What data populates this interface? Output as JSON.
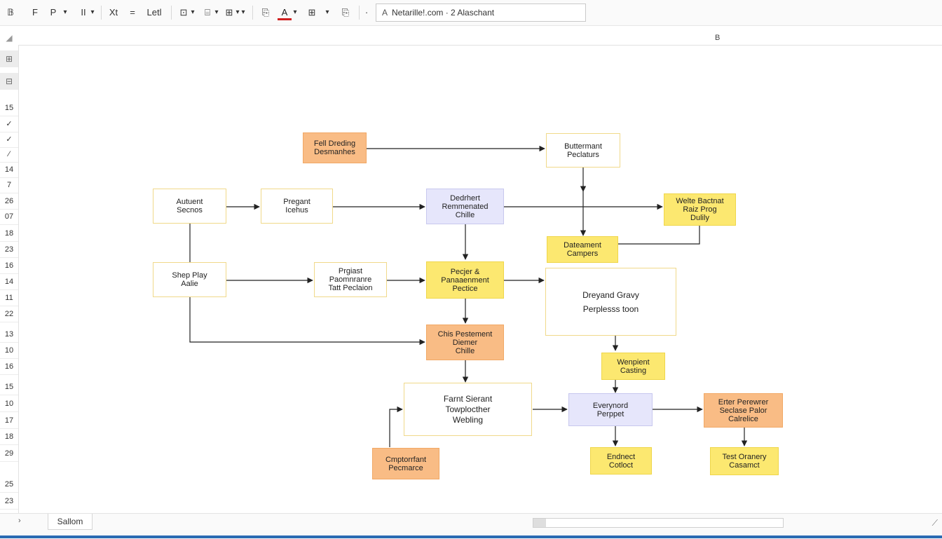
{
  "toolbar": {
    "items": [
      "𝔹",
      "F",
      "P",
      "▾",
      "II",
      "▾",
      "Xt",
      "=",
      "Letl",
      "⊡",
      "▾",
      "⌸",
      "▾",
      "⊞",
      "▾",
      "▾",
      "⎘",
      "A",
      "▾",
      "⊞",
      "▾",
      "⎘",
      "·"
    ],
    "address": {
      "glyph": "A",
      "text": "Netarille!.com · 2 Alaschant"
    }
  },
  "column_header": {
    "corner": "◢",
    "col_b": "B"
  },
  "gutter": {
    "icons": [
      "⊞",
      "⊟"
    ],
    "rows": [
      "15",
      "✓",
      "✓",
      "⁄",
      "14",
      "7",
      "26",
      "07",
      "18",
      "23",
      "16",
      "14",
      "11",
      "22",
      "13",
      "10",
      "16",
      "15",
      "10",
      "17",
      "18",
      "29",
      "25",
      "23"
    ]
  },
  "nodes": {
    "fell_dreding": "Fell Dreding\nDesmanhes",
    "buttermant": "Buttermant\nPeclaturs",
    "autuent": "Autuent\nSecnos",
    "pregant": "Pregant\nIcehus",
    "dedrhert": "Dedrhert\nRemmenated\nChille",
    "welte_bactnat": "Welte Bactnat\nRaiz Prog\nDulily",
    "dateament": "Dateament\nCampers",
    "shep_play": "Shep Play\nAalie",
    "prgiast": "Prgiast\nPaomnranre\nTatt Peclaion",
    "pecjer": "Pecjer &\nPanaaenment\nPectice",
    "dreyand_gravy": "Dreyand Gravy\nPerplesss toon",
    "chis_pestement": "Chis Pestement\nDiemer\nChille",
    "wenpient": "Wenpient\nCasting",
    "farnt_sierant": "Farnt Sierant\nTowplocther\nWebling",
    "everynord": "Everynord\nPerppet",
    "erter_perewrer": "Erter Perewrer\nSeclase Palor\nCalrelice",
    "cmptorrfant": "Cmptorrfant\nPecmarce",
    "endnect": "Endnect\nCotloct",
    "test_oranery": "Test Oranery\nCasamct"
  },
  "bottom": {
    "nav": "›",
    "sheet_tab": "Sallom",
    "resize": "⟋"
  },
  "colors": {
    "orange": "#f9bc85",
    "yellow": "#fce870",
    "lavender": "#e6e6fb",
    "stroke": "#222222"
  }
}
